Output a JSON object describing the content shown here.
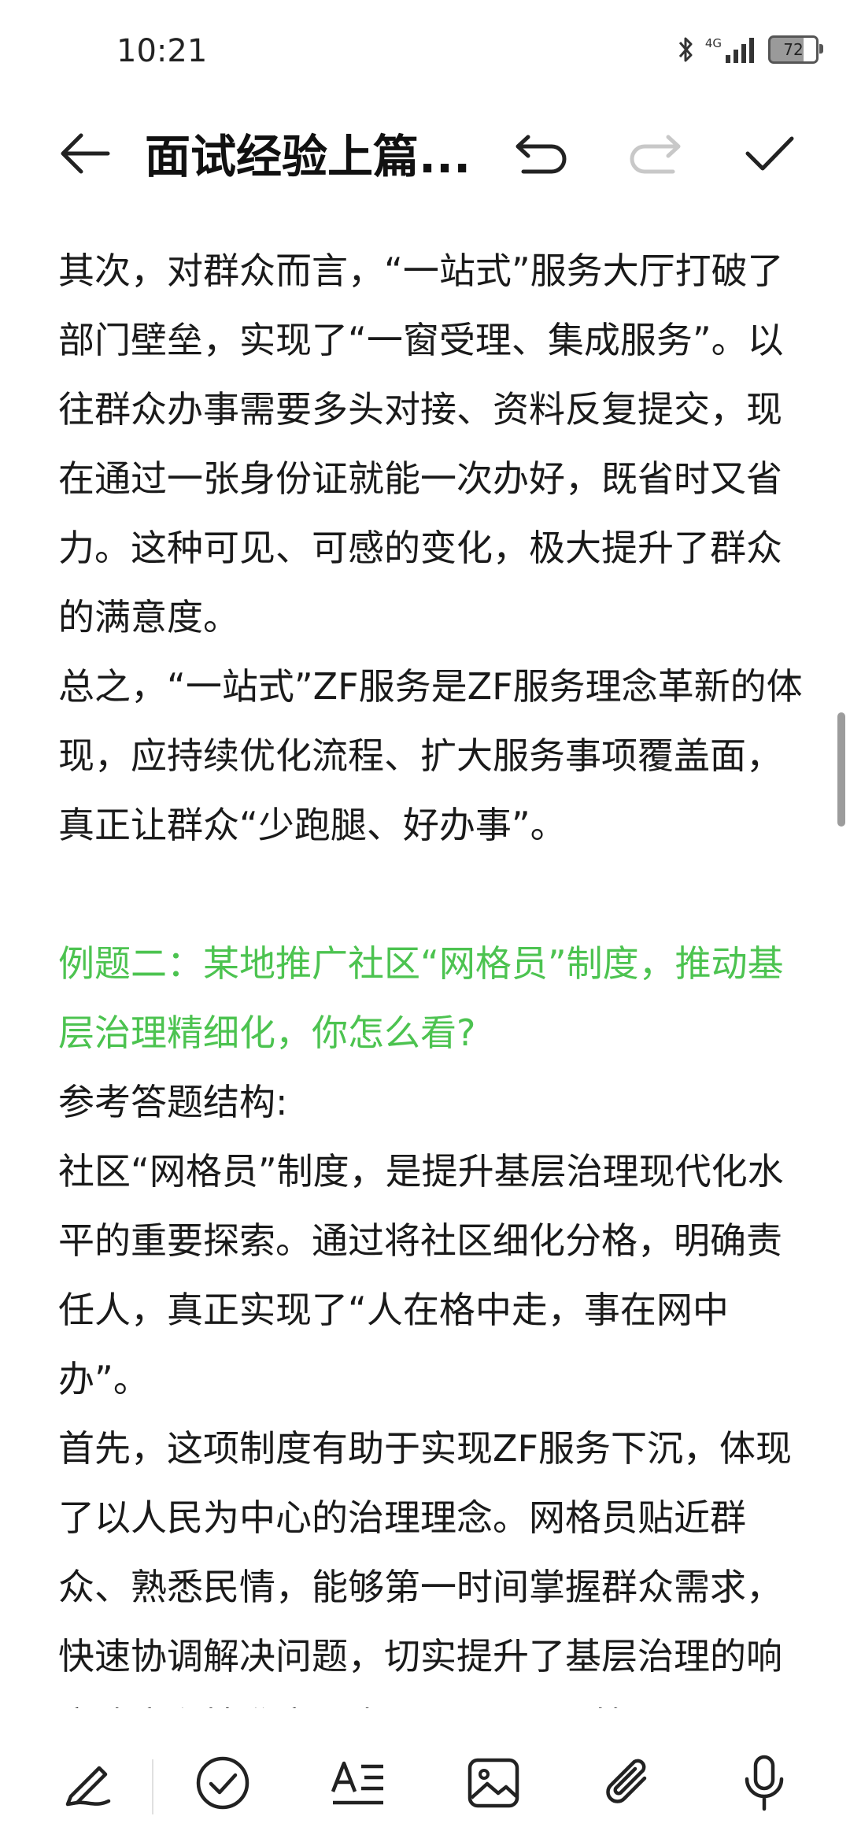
{
  "status_bar": {
    "time": "10:21",
    "network": "4G",
    "battery_level": "72",
    "icons": [
      "bluetooth-icon",
      "signal-icon",
      "battery-icon"
    ]
  },
  "toolbar": {
    "title": "面试经验上篇...",
    "back_icon": "arrow-left-icon",
    "undo_icon": "undo-icon",
    "redo_icon": "redo-icon",
    "done_icon": "check-icon"
  },
  "content": {
    "paragraphs": [
      {
        "text": "其次，对群众而言，“一站式”服务大厅打破了部门壁垒，实现了“一窗受理、集成服务”。以往群众办事需要多头对接、资料反复提交，现在通过一张身份证就能一次办好，既省时又省力。这种可见、可感的变化，极大提升了群众的满意度。",
        "style": "normal"
      },
      {
        "text": "总之，“一站式”ZF服务是ZF服务理念革新的体现，应持续优化流程、扩大服务事项覆盖面，真正让群众“少跑腿、好办事”。",
        "style": "normal"
      },
      {
        "text": "",
        "style": "blank"
      },
      {
        "text": "例题二：某地推广社区“网格员”制度，推动基层治理精细化，你怎么看?",
        "style": "heading"
      },
      {
        "text": "参考答题结构:",
        "style": "normal"
      },
      {
        "text": "社区“网格员”制度，是提升基层治理现代化水平的重要探索。通过将社区细化分格，明确责任人，真正实现了“人在格中走，事在网中办”。",
        "style": "normal"
      },
      {
        "text": "首先，这项制度有助于实现ZF服务下沉，体现了以人民为中心的治理理念。网格员贴近群众、熟悉民情，能够第一时间掌握群众需求，快速协调解决问题，切实提升了基层治理的响应速度和精准度，也展现了ZF从“管",
        "style": "normal"
      }
    ],
    "heading_color": "#4cc350"
  },
  "bottom_bar": {
    "icons": [
      "pen-icon",
      "checklist-icon",
      "text-format-icon",
      "image-icon",
      "attachment-icon",
      "microphone-icon"
    ]
  }
}
